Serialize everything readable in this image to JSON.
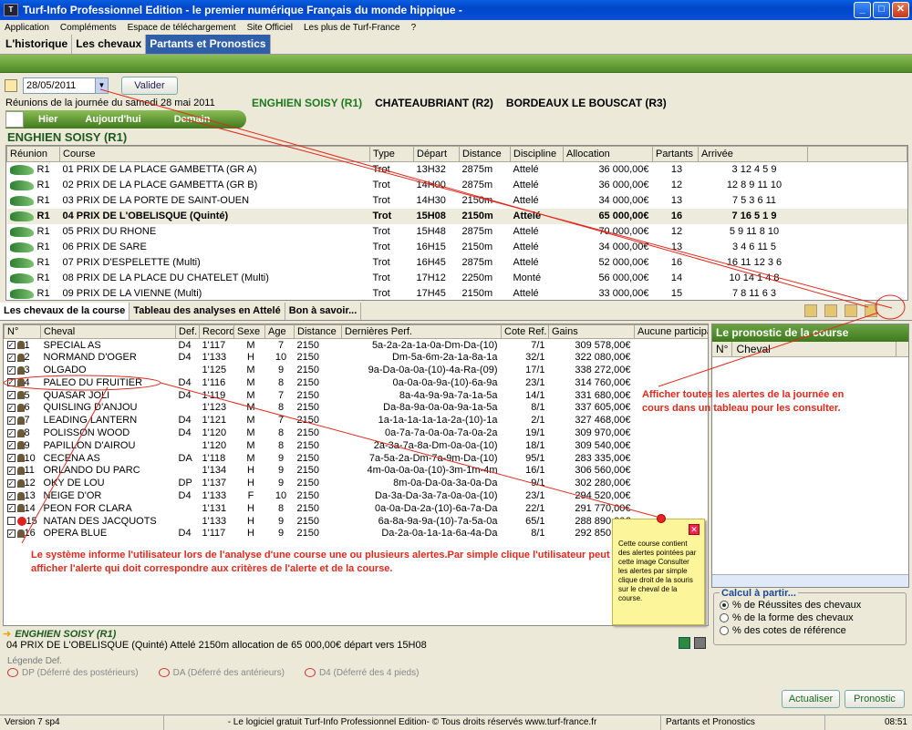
{
  "window": {
    "title": "Turf-Info Professionnel Edition - le premier numérique Français du monde hippique -"
  },
  "menu": [
    "Application",
    "Compléments",
    "Espace de téléchargement",
    "Site Officiel",
    "Les plus de Turf-France",
    "?"
  ],
  "tabs": [
    "L'historique",
    "Les chevaux",
    "Partants et Pronostics"
  ],
  "date": {
    "value": "28/05/2011",
    "button": "Valider"
  },
  "reunions_title": "Réunions de la journée du samedi 28 mai 2011",
  "venues": [
    "ENGHIEN SOISY (R1)",
    "CHATEAUBRIANT (R2)",
    "BORDEAUX LE BOUSCAT (R3)"
  ],
  "days": [
    "Hier",
    "Aujourd'hui",
    "Demain"
  ],
  "section_title": "ENGHIEN SOISY (R1)",
  "race_headers": [
    "Réunion",
    "Course",
    "Type",
    "Départ",
    "Distance",
    "Discipline",
    "Allocation",
    "Partants",
    "Arrivée"
  ],
  "races": [
    [
      "R1",
      "01 PRIX DE LA PLACE GAMBETTA (GR A)",
      "Trot",
      "13H32",
      "2875m",
      "Attelé",
      "36 000,00€",
      "13",
      "3 12 4 5 9"
    ],
    [
      "R1",
      "02 PRIX DE LA PLACE GAMBETTA (GR B)",
      "Trot",
      "14H00",
      "2875m",
      "Attelé",
      "36 000,00€",
      "12",
      "12 8 9 11 10"
    ],
    [
      "R1",
      "03 PRIX DE LA PORTE DE SAINT-OUEN",
      "Trot",
      "14H30",
      "2150m",
      "Attelé",
      "34 000,00€",
      "13",
      "7 5 3 6 11"
    ],
    [
      "R1",
      "04 PRIX DE L'OBELISQUE (Quinté)",
      "Trot",
      "15H08",
      "2150m",
      "Attelé",
      "65 000,00€",
      "16",
      "7 16 5 1 9"
    ],
    [
      "R1",
      "05 PRIX DU RHONE",
      "Trot",
      "15H48",
      "2875m",
      "Attelé",
      "70 000,00€",
      "12",
      "5 9 11 8 10"
    ],
    [
      "R1",
      "06 PRIX DE SARE",
      "Trot",
      "16H15",
      "2150m",
      "Attelé",
      "34 000,00€",
      "13",
      "3 4 6 11 5"
    ],
    [
      "R1",
      "07 PRIX D'ESPELETTE (Multi)",
      "Trot",
      "16H45",
      "2875m",
      "Attelé",
      "52 000,00€",
      "16",
      "16 11 12 3 6"
    ],
    [
      "R1",
      "08 PRIX DE LA PLACE DU CHATELET (Multi)",
      "Trot",
      "17H12",
      "2250m",
      "Monté",
      "56 000,00€",
      "14",
      "10 14 1 4 8"
    ],
    [
      "R1",
      "09 PRIX DE LA VIENNE (Multi)",
      "Trot",
      "17H45",
      "2150m",
      "Attelé",
      "33 000,00€",
      "15",
      "7 8 11 6 3"
    ]
  ],
  "subtabs": [
    "Les chevaux de la course",
    "Tableau des analyses en Attelé",
    "Bon à savoir..."
  ],
  "horse_headers": [
    "N°",
    "Cheval",
    "Def.",
    "Record",
    "Sexe",
    "Age",
    "Distance",
    "Dernières Perf.",
    "Cote Ref.",
    "Gains",
    "Aucune participat"
  ],
  "horses": [
    [
      "1",
      "SPECIAL AS",
      "D4",
      "1'117",
      "M",
      "7",
      "2150",
      "5a-2a-2a-1a-0a-Dm-Da-(10)",
      "7/1",
      "309 578,00€"
    ],
    [
      "2",
      "NORMAND D'OGER",
      "D4",
      "1'133",
      "H",
      "10",
      "2150",
      "Dm-5a-6m-2a-1a-8a-1a",
      "32/1",
      "322 080,00€"
    ],
    [
      "3",
      "OLGADO",
      "",
      "1'125",
      "M",
      "9",
      "2150",
      "9a-Da-0a-0a-(10)-4a-Ra-(09)",
      "17/1",
      "338 272,00€"
    ],
    [
      "4",
      "PALEO DU FRUITIER",
      "D4",
      "1'116",
      "M",
      "8",
      "2150",
      "0a-0a-0a-9a-(10)-6a-9a",
      "23/1",
      "314 760,00€"
    ],
    [
      "5",
      "QUASAR JOLI",
      "D4",
      "1'119",
      "M",
      "7",
      "2150",
      "8a-4a-9a-9a-7a-1a-5a",
      "14/1",
      "331 680,00€"
    ],
    [
      "6",
      "QUISLING D'ANJOU",
      "",
      "1'123",
      "M",
      "8",
      "2150",
      "Da-8a-9a-0a-0a-9a-1a-5a",
      "8/1",
      "337 605,00€"
    ],
    [
      "7",
      "LEADING LANTERN",
      "D4",
      "1'121",
      "M",
      "7",
      "2150",
      "1a-1a-1a-1a-1a-2a-(10)-1a",
      "2/1",
      "327 468,00€"
    ],
    [
      "8",
      "POLISSON WOOD",
      "D4",
      "1'120",
      "M",
      "8",
      "2150",
      "0a-7a-7a-0a-0a-7a-0a-2a",
      "19/1",
      "309 970,00€"
    ],
    [
      "9",
      "PAPILLON D'AIROU",
      "",
      "1'120",
      "M",
      "8",
      "2150",
      "2a-3a-7a-8a-Dm-0a-0a-(10)",
      "18/1",
      "309 540,00€"
    ],
    [
      "10",
      "CECENA AS",
      "DA",
      "1'118",
      "M",
      "9",
      "2150",
      "7a-5a-2a-Dm-7a-9m-Da-(10)",
      "95/1",
      "283 335,00€"
    ],
    [
      "11",
      "ORLANDO DU PARC",
      "",
      "1'134",
      "H",
      "9",
      "2150",
      "4m-0a-0a-0a-(10)-3m-1m-4m",
      "16/1",
      "306 560,00€"
    ],
    [
      "12",
      "OKY DE LOU",
      "DP",
      "1'137",
      "H",
      "9",
      "2150",
      "8m-0a-Da-0a-3a-0a-Da",
      "9/1",
      "302 280,00€"
    ],
    [
      "13",
      "NEIGE D'OR",
      "D4",
      "1'133",
      "F",
      "10",
      "2150",
      "Da-3a-Da-3a-7a-0a-0a-(10)",
      "23/1",
      "294 520,00€"
    ],
    [
      "14",
      "PEON FOR CLARA",
      "",
      "1'131",
      "H",
      "8",
      "2150",
      "0a-0a-Da-2a-(10)-6a-7a-Da",
      "22/1",
      "291 770,00€"
    ],
    [
      "15",
      "NATAN DES JACQUOTS",
      "",
      "1'133",
      "H",
      "9",
      "2150",
      "6a-8a-9a-9a-(10)-7a-5a-0a",
      "65/1",
      "288 890,00€"
    ],
    [
      "16",
      "OPERA BLUE",
      "D4",
      "1'117",
      "H",
      "9",
      "2150",
      "Da-2a-0a-1a-1a-6a-4a-Da",
      "8/1",
      "292 850,00€"
    ]
  ],
  "pronostic": {
    "title": "Le pronostic de la course",
    "cols": [
      "N°",
      "Cheval"
    ]
  },
  "calc": {
    "title": "Calcul à partir...",
    "options": [
      "% de Réussites des chevaux",
      "% de la forme des chevaux",
      "% des cotes de référence"
    ],
    "selected": 0
  },
  "buttons": {
    "actualiser": "Actualiser",
    "pronostic": "Pronostic"
  },
  "info": {
    "venue": "ENGHIEN SOISY (R1)",
    "race": "04 PRIX DE L'OBELISQUE (Quinté) Attelé 2150m allocation de 65 000,00€ départ vers 15H08"
  },
  "legend": {
    "title": "Légende Def.",
    "items": [
      "DP (Déferré des postérieurs)",
      "DA (Déferré des antérieurs)",
      "D4 (Déferré des 4 pieds)"
    ]
  },
  "annotations": {
    "alert_text": "Le système informe l'utilisateur lors de l'analyse d'une course une ou plusieurs alertes.Par simple clique l'utilisateur peut afficher l'alerte qui doit correspondre aux critères de l'alerte et de la course.",
    "right_text": "Afficher toutes les alertes de la journée en cours dans un tableau pour les consulter.",
    "note_text": "Cette course contient des alertes pointées par cette image Consulter les alertes par simple clique droit de la souris sur le cheval de la course."
  },
  "status": {
    "version": "Version 7 sp4",
    "copyright": "- Le logiciel gratuit Turf-Info Professionnel Edition- © Tous droits réservés www.turf-france.fr",
    "section": "Partants et Pronostics",
    "time": "08:51"
  },
  "colors": {
    "title_blue": "#0046c8",
    "green_bar": "#4f8a26",
    "annotation_red": "#e0291c",
    "note_yellow": "#fdf59a"
  }
}
